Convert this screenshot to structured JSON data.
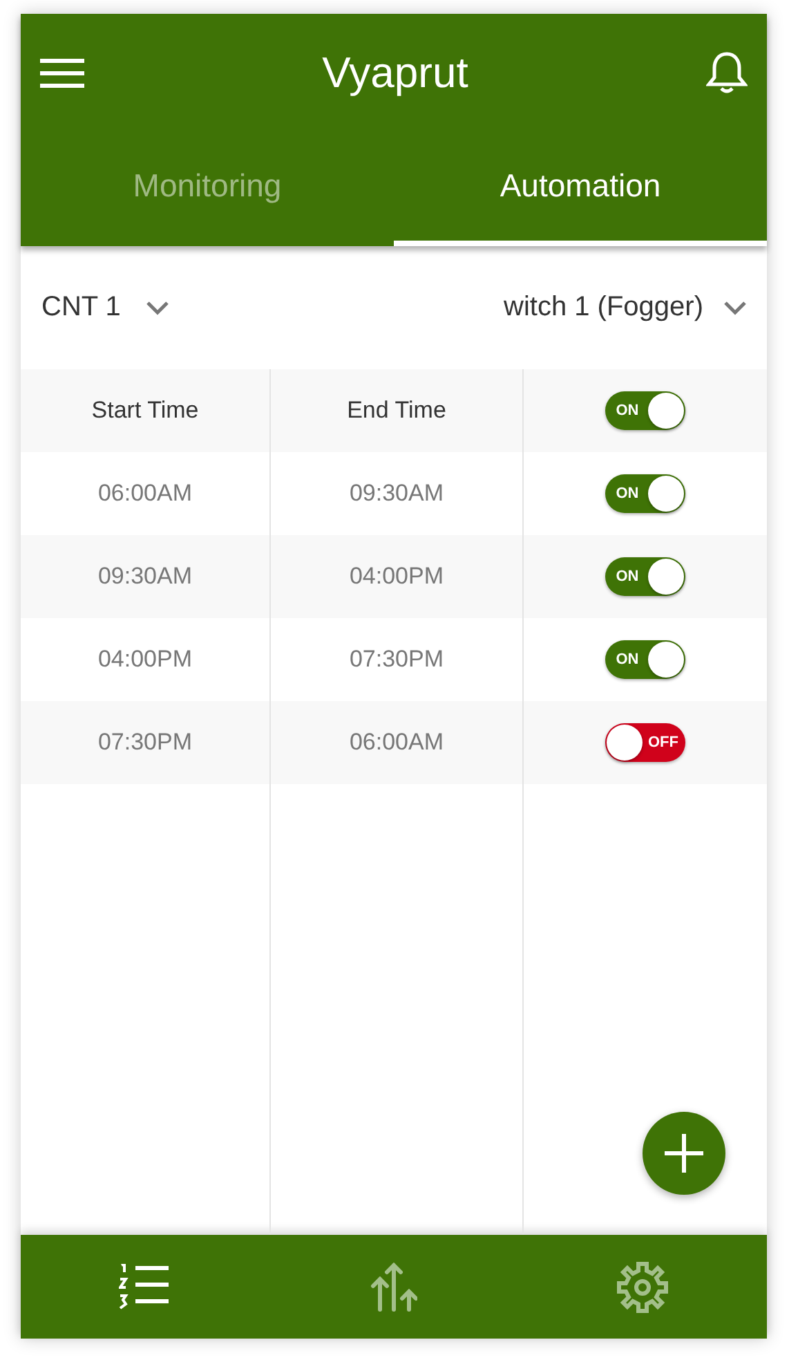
{
  "app_bar": {
    "title": "Vyaprut"
  },
  "tabs": [
    {
      "label": "Monitoring",
      "selected": false
    },
    {
      "label": "Automation",
      "selected": true
    }
  ],
  "selectors": {
    "controller": "CNT 1",
    "switch": "witch 1 (Fogger)"
  },
  "table": {
    "columns": [
      "Start Time",
      "End Time"
    ],
    "header_toggle": {
      "label": "ON",
      "on": true
    },
    "rows": [
      {
        "start": "06:00AM",
        "end": "09:30AM",
        "toggle": {
          "label": "ON",
          "on": true
        }
      },
      {
        "start": "09:30AM",
        "end": "04:00PM",
        "toggle": {
          "label": "ON",
          "on": true
        }
      },
      {
        "start": "04:00PM",
        "end": "07:30PM",
        "toggle": {
          "label": "ON",
          "on": true
        }
      },
      {
        "start": "07:30PM",
        "end": "06:00AM",
        "toggle": {
          "label": "OFF",
          "on": false
        }
      }
    ]
  },
  "bottom_nav": [
    {
      "kind": "list",
      "selected": true
    },
    {
      "kind": "arrows",
      "selected": false
    },
    {
      "kind": "settings",
      "selected": false
    }
  ]
}
